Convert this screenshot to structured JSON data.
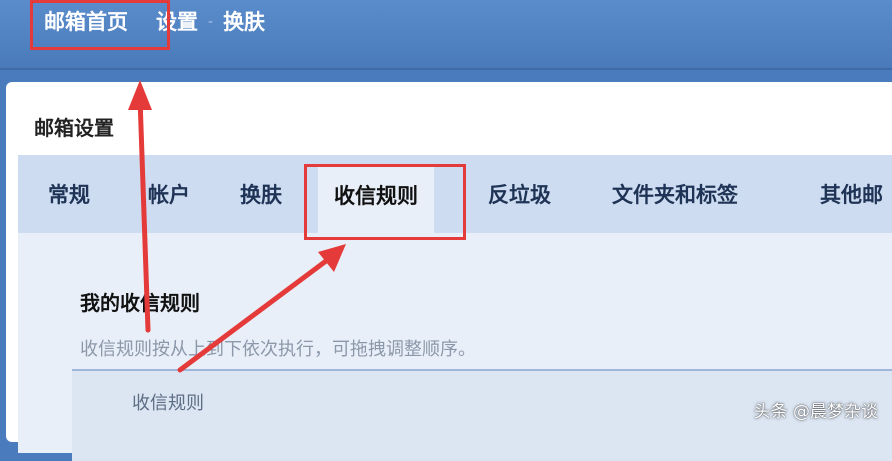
{
  "logo_fragment": "",
  "topnav": {
    "home": "邮箱首页",
    "settings": "设置",
    "skin": "换肤",
    "separator": "-"
  },
  "page": {
    "title": "邮箱设置"
  },
  "tabs": [
    {
      "label": "常规"
    },
    {
      "label": "帐户"
    },
    {
      "label": "换肤"
    },
    {
      "label": "收信规则",
      "active": true
    },
    {
      "label": "反垃圾"
    },
    {
      "label": "文件夹和标签"
    },
    {
      "label": "其他邮"
    }
  ],
  "rules": {
    "title": "我的收信规则",
    "description": "收信规则按从上到下依次执行，可拖拽调整顺序。",
    "table_header": "收信规则"
  },
  "watermark": "头条 @晨梦杂谈",
  "colors": {
    "topbar": "#4a7bbd",
    "tabbar": "#cddcf0",
    "panel": "#e9eff8",
    "annotation": "#e53a3a"
  }
}
